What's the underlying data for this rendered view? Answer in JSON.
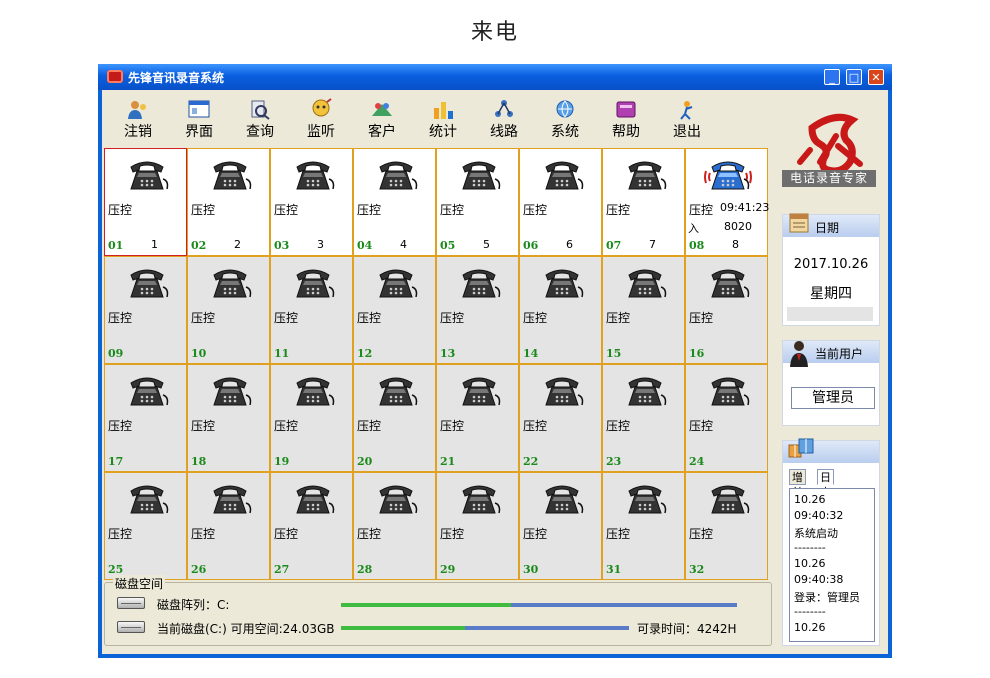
{
  "page": {
    "heading": "来电"
  },
  "window": {
    "title": "先锋音讯录音系统",
    "minimize": "_",
    "maximize": "□",
    "close": "✕"
  },
  "toolbar": [
    {
      "label": "注销",
      "icon": "logout-user-icon"
    },
    {
      "label": "界面",
      "icon": "interface-icon"
    },
    {
      "label": "查询",
      "icon": "query-icon"
    },
    {
      "label": "监听",
      "icon": "monitor-icon"
    },
    {
      "label": "客户",
      "icon": "customer-icon"
    },
    {
      "label": "统计",
      "icon": "statistics-icon"
    },
    {
      "label": "线路",
      "icon": "line-icon"
    },
    {
      "label": "系统",
      "icon": "system-icon"
    },
    {
      "label": "帮助",
      "icon": "help-icon"
    },
    {
      "label": "退出",
      "icon": "exit-icon"
    }
  ],
  "channels": [
    {
      "ext": "01",
      "line": "1",
      "state": "压控",
      "status": "selected"
    },
    {
      "ext": "02",
      "line": "2",
      "state": "压控",
      "status": "connected"
    },
    {
      "ext": "03",
      "line": "3",
      "state": "压控",
      "status": "connected"
    },
    {
      "ext": "04",
      "line": "4",
      "state": "压控",
      "status": "connected"
    },
    {
      "ext": "05",
      "line": "5",
      "state": "压控",
      "status": "connected"
    },
    {
      "ext": "06",
      "line": "6",
      "state": "压控",
      "status": "connected"
    },
    {
      "ext": "07",
      "line": "7",
      "state": "压控",
      "status": "connected"
    },
    {
      "ext": "08",
      "line": "8",
      "state": "压控",
      "status": "ringing",
      "time": "09:41:23",
      "direction": "入",
      "number": "8020"
    },
    {
      "ext": "09",
      "state": "压控",
      "status": "idle"
    },
    {
      "ext": "10",
      "state": "压控",
      "status": "idle"
    },
    {
      "ext": "11",
      "state": "压控",
      "status": "idle"
    },
    {
      "ext": "12",
      "state": "压控",
      "status": "idle"
    },
    {
      "ext": "13",
      "state": "压控",
      "status": "idle"
    },
    {
      "ext": "14",
      "state": "压控",
      "status": "idle"
    },
    {
      "ext": "15",
      "state": "压控",
      "status": "idle"
    },
    {
      "ext": "16",
      "state": "压控",
      "status": "idle"
    },
    {
      "ext": "17",
      "state": "压控",
      "status": "idle"
    },
    {
      "ext": "18",
      "state": "压控",
      "status": "idle"
    },
    {
      "ext": "19",
      "state": "压控",
      "status": "idle"
    },
    {
      "ext": "20",
      "state": "压控",
      "status": "idle"
    },
    {
      "ext": "21",
      "state": "压控",
      "status": "idle"
    },
    {
      "ext": "22",
      "state": "压控",
      "status": "idle"
    },
    {
      "ext": "23",
      "state": "压控",
      "status": "idle"
    },
    {
      "ext": "24",
      "state": "压控",
      "status": "idle"
    },
    {
      "ext": "25",
      "state": "压控",
      "status": "idle"
    },
    {
      "ext": "26",
      "state": "压控",
      "status": "idle"
    },
    {
      "ext": "27",
      "state": "压控",
      "status": "idle"
    },
    {
      "ext": "28",
      "state": "压控",
      "status": "idle"
    },
    {
      "ext": "29",
      "state": "压控",
      "status": "idle"
    },
    {
      "ext": "30",
      "state": "压控",
      "status": "idle"
    },
    {
      "ext": "31",
      "state": "压控",
      "status": "idle"
    },
    {
      "ext": "32",
      "state": "压控",
      "status": "idle"
    }
  ],
  "disk": {
    "legend": "磁盘空间",
    "array_label": "磁盘阵列：C:",
    "current_label": "当前磁盘(C:) 可用空间:24.03GB",
    "record_time": "可录时间：4242H",
    "array_used_fraction": 0.43,
    "current_used_fraction": 0.43
  },
  "side": {
    "logo_text": "电话录音专家",
    "date_title": "日期",
    "date": "2017.10.26",
    "weekday": "星期四",
    "user_title": "当前用户",
    "user": "管理员",
    "tabs": [
      "增益",
      "日志"
    ],
    "log": [
      "10.26",
      "09:40:32",
      "系统启动",
      "--------",
      "10.26",
      "09:40:38",
      "登录：管理员",
      "--------",
      "10.26"
    ]
  },
  "colors": {
    "titlebar": "#0a5fe0",
    "cell_border": "#e0a020",
    "extension_number": "#1a8a1a",
    "selected_border": "#d02020",
    "ringing_phone": "#2a6ed0"
  }
}
